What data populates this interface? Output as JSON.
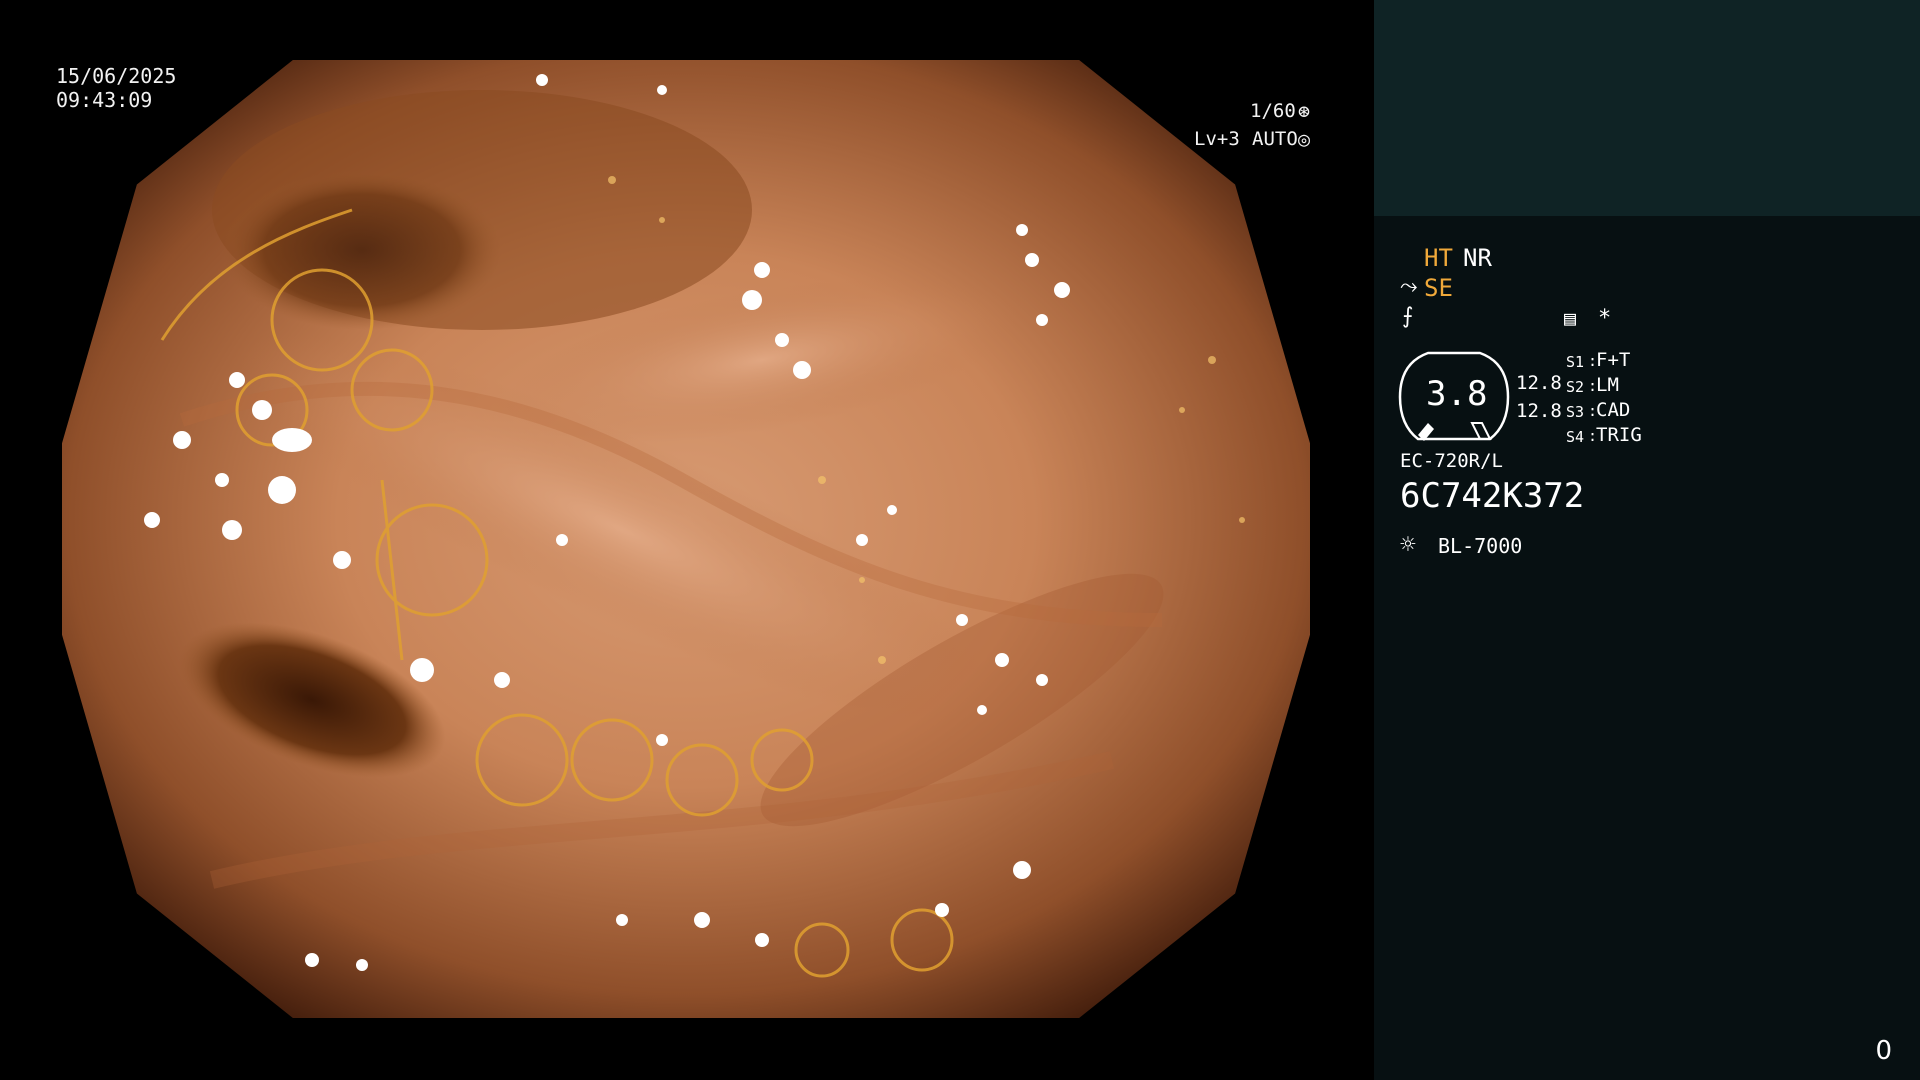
{
  "overlay": {
    "date": "15/06/2025",
    "time": "09:43:09",
    "shutter": "1/60",
    "shutter_icon": "aperture-icon",
    "level": "Lv+3",
    "auto_mode": "AUTO",
    "auto_icon": "iris-icon"
  },
  "panel": {
    "mode_ht": "HT",
    "mode_nr": "NR",
    "se_icon": "enhance-curve-icon",
    "se_label": "SE",
    "curve_icon": "tone-curve-icon",
    "memory_icon": "memory-card-icon",
    "asterisk": "*",
    "gauge_value": "3.8",
    "gauge_sub_top": "12.8",
    "gauge_sub_bottom": "12.8",
    "switches": [
      {
        "key": "S1",
        "value": "F+T"
      },
      {
        "key": "S2",
        "value": "LM"
      },
      {
        "key": "S3",
        "value": "CAD"
      },
      {
        "key": "S4",
        "value": "TRIG"
      }
    ],
    "scope_model": "EC-720R/L",
    "serial": "6C742K372",
    "light_icon": "light-source-icon",
    "light_source": "BL-7000",
    "counter": "0"
  },
  "colors": {
    "accent_orange": "#f0a93a",
    "panel_top_bg": "#0f2325",
    "panel_bg": "#071012"
  }
}
